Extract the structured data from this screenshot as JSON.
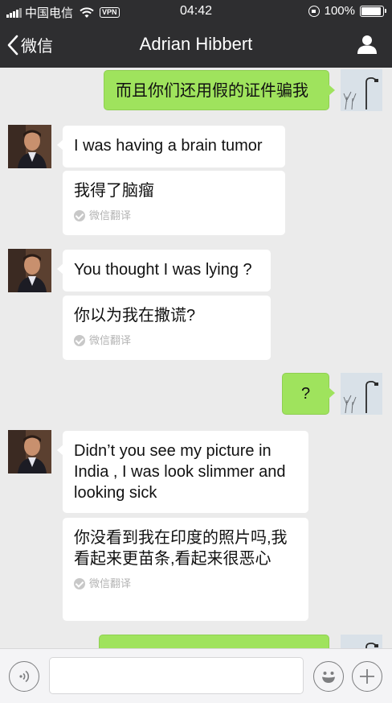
{
  "status_bar": {
    "carrier": "中国电信",
    "vpn": "VPN",
    "time": "04:42",
    "battery": "100%",
    "battery_level": 1.0
  },
  "nav": {
    "back_label": "微信",
    "title": "Adrian Hibbert"
  },
  "messages": [
    {
      "side": "right",
      "text": "而且你们还用假的证件骗我"
    },
    {
      "side": "left",
      "text": "I was having a brain tumor"
    },
    {
      "side": "left",
      "text": "我得了脑瘤",
      "translation_label": "微信翻译"
    },
    {
      "side": "left",
      "text": "You thought I was lying ?"
    },
    {
      "side": "left",
      "text": "你以为我在撒谎?",
      "translation_label": "微信翻译"
    },
    {
      "side": "right",
      "text": "?"
    },
    {
      "side": "left",
      "text": "Didn’t you see my picture in India , I was look slimmer and looking sick"
    },
    {
      "side": "left",
      "text": "你没看到我在印度的照片吗,我看起来更苗条,看起来很恶心",
      "translation_label": "微信翻译"
    }
  ],
  "colors": {
    "header": "#2e2e30",
    "chat_background": "#ebebeb",
    "outgoing_bubble": "#9fe35d",
    "incoming_bubble": "#ffffff"
  },
  "icons": {
    "back": "chevron-left-icon",
    "profile": "person-icon",
    "voice": "voice-icon",
    "emoji": "emoji-icon",
    "more": "plus-icon"
  }
}
